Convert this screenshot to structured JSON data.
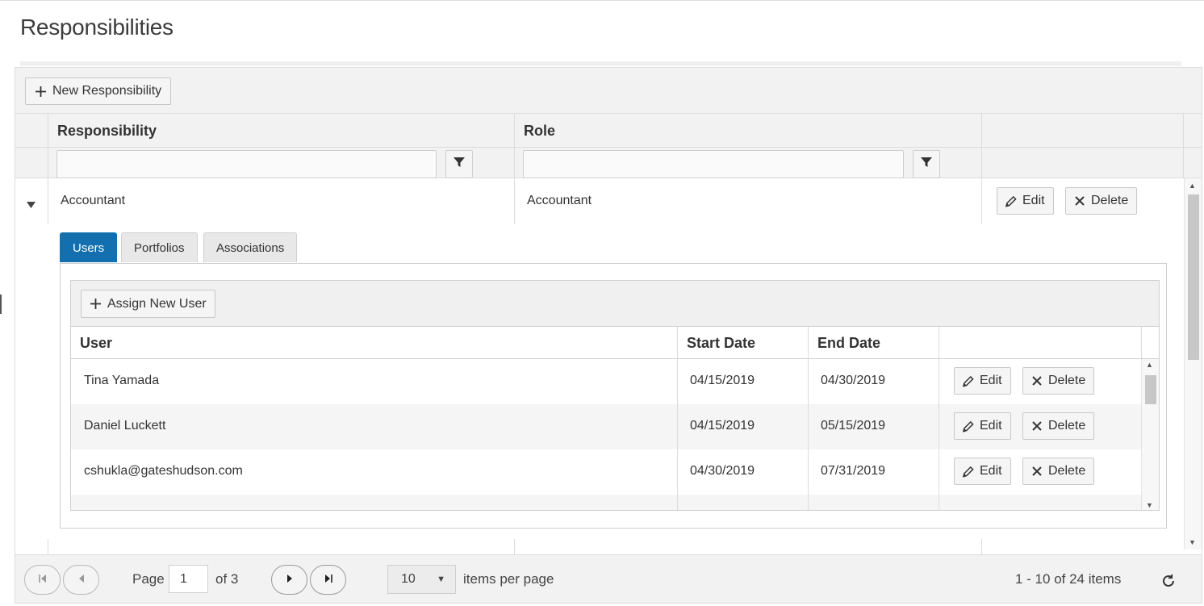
{
  "page": {
    "title": "Responsibilities"
  },
  "toolbar": {
    "new_label": "New Responsibility"
  },
  "columns": {
    "responsibility": "Responsibility",
    "role": "Role"
  },
  "rows": [
    {
      "responsibility": "Accountant",
      "role": "Accountant",
      "edit_label": "Edit",
      "delete_label": "Delete"
    }
  ],
  "detail": {
    "tabs": [
      {
        "label": "Users",
        "active": true
      },
      {
        "label": "Portfolios",
        "active": false
      },
      {
        "label": "Associations",
        "active": false
      }
    ],
    "users_grid": {
      "assign_label": "Assign New User",
      "columns": {
        "user": "User",
        "start": "Start Date",
        "end": "End Date"
      },
      "rows": [
        {
          "user": "Tina Yamada",
          "start": "04/15/2019",
          "end": "04/30/2019",
          "edit_label": "Edit",
          "delete_label": "Delete"
        },
        {
          "user": "Daniel Luckett",
          "start": "04/15/2019",
          "end": "05/15/2019",
          "edit_label": "Edit",
          "delete_label": "Delete"
        },
        {
          "user": "cshukla@gateshudson.com",
          "start": "04/30/2019",
          "end": "07/31/2019",
          "edit_label": "Edit",
          "delete_label": "Delete"
        }
      ]
    }
  },
  "pager": {
    "page_label": "Page",
    "current_page": "1",
    "of_label": "of 3",
    "page_size": "10",
    "items_per_page_label": "items per page",
    "summary": "1 - 10 of 24 items"
  },
  "colors": {
    "accent": "#136fae"
  },
  "icons": [
    "plus-icon",
    "filter-icon",
    "expand-caret-icon",
    "pencil-icon",
    "close-icon",
    "first-page-icon",
    "prev-page-icon",
    "next-page-icon",
    "last-page-icon",
    "refresh-icon"
  ]
}
